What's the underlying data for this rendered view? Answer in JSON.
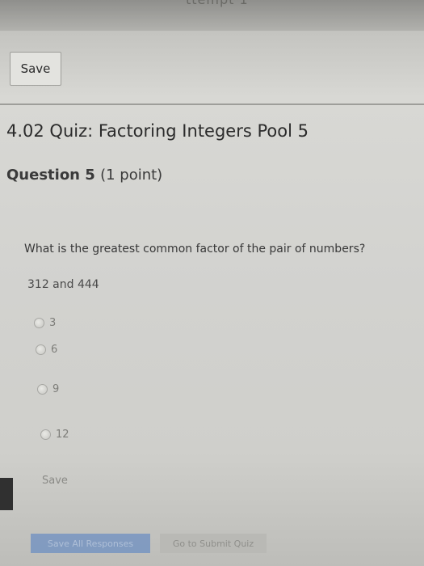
{
  "header": {
    "partial_title": "ttempt 1"
  },
  "toolbar": {
    "save_label": "Save"
  },
  "quiz": {
    "title": "4.02 Quiz: Factoring Integers Pool 5"
  },
  "question": {
    "number_label": "Question 5",
    "points_label": "(1 point)",
    "prompt": "What is the greatest common factor of the pair of numbers?",
    "numbers": "312 and 444",
    "options": [
      {
        "label": "3",
        "selected": false
      },
      {
        "label": "6",
        "selected": false
      },
      {
        "label": "9",
        "selected": false
      },
      {
        "label": "12",
        "selected": false
      }
    ],
    "save_label": "Save"
  },
  "footer": {
    "save_all_label": "Save All Responses",
    "submit_label": "Go to Submit Quiz"
  }
}
